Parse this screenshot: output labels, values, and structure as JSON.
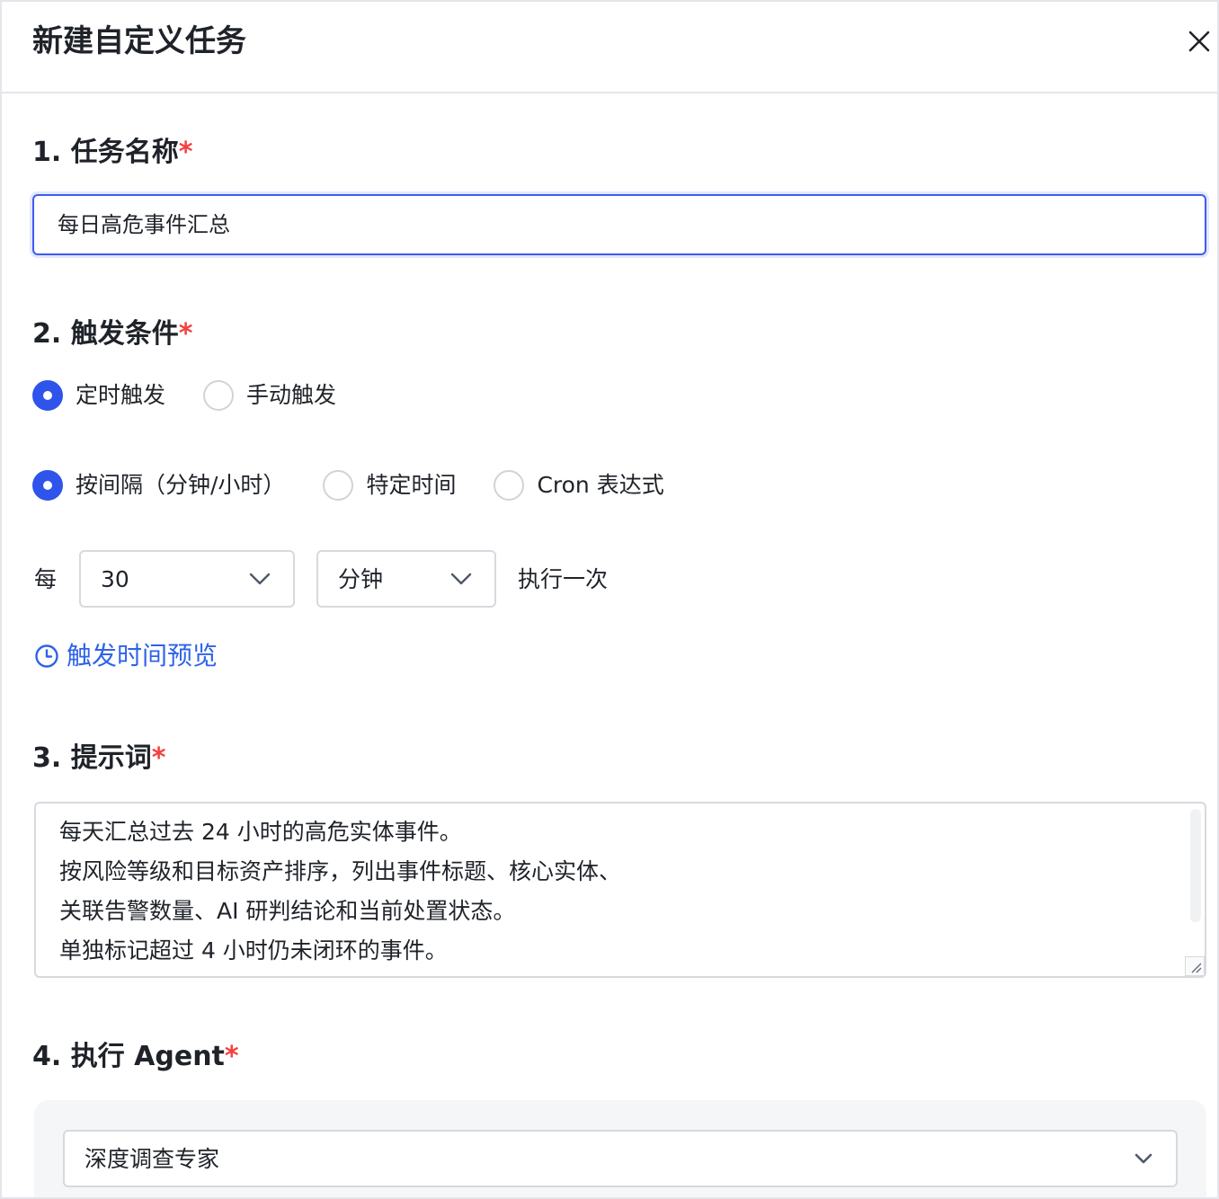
{
  "header": {
    "title": "新建自定义任务",
    "close_icon": "close-icon"
  },
  "sections": {
    "name": {
      "title": "1. 任务名称",
      "required": "*",
      "value": "每日高危事件汇总"
    },
    "trigger": {
      "title": "2. 触发条件",
      "required": "*",
      "modes": [
        {
          "label": "定时触发",
          "selected": true
        },
        {
          "label": "手动触发",
          "selected": false
        }
      ],
      "schedule_types": [
        {
          "label": "按间隔（分钟/小时）",
          "selected": true
        },
        {
          "label": "特定时间",
          "selected": false
        },
        {
          "label": "Cron 表达式",
          "selected": false
        }
      ],
      "each_label": "每",
      "interval_value": "30",
      "interval_unit": "分钟",
      "once_label": "执行一次",
      "preview_label": "触发时间预览"
    },
    "prompt": {
      "title": "3. 提示词",
      "required": "*",
      "lines": [
        "每天汇总过去 24 小时的高危实体事件。",
        "按风险等级和目标资产排序，列出事件标题、核心实体、",
        "关联告警数量、AI 研判结论和当前处置状态。",
        "单独标记超过 4 小时仍未闭环的事件。"
      ]
    },
    "agent": {
      "title": "4. 执行 Agent",
      "required": "*",
      "value": "深度调查专家"
    }
  },
  "colors": {
    "accent": "#2f54eb",
    "link": "#2f63e8",
    "required": "#f53f3f",
    "border": "#d6d9de"
  }
}
